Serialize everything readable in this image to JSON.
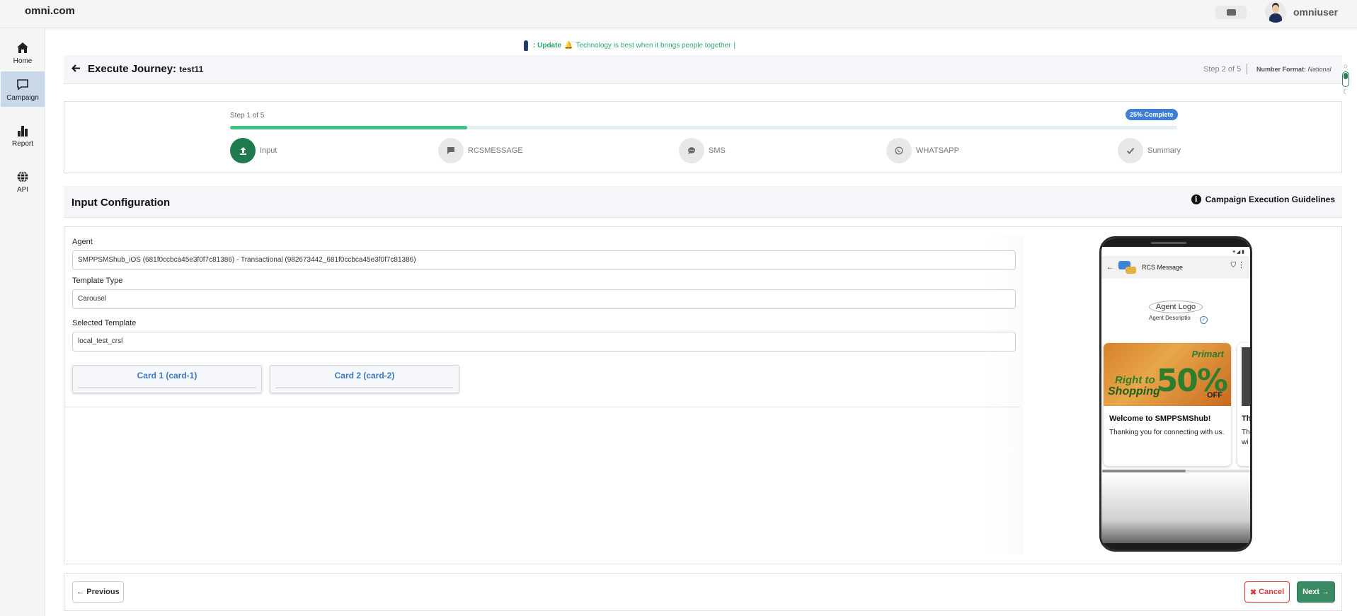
{
  "app": {
    "brand": "omni.com",
    "username": "omniuser"
  },
  "sidebar": {
    "items": [
      {
        "label": "Home",
        "icon": "home-icon"
      },
      {
        "label": "Campaign",
        "icon": "chat-icon",
        "active": true
      },
      {
        "label": "Report",
        "icon": "bar-chart-icon"
      },
      {
        "label": "API",
        "icon": "globe-icon"
      }
    ]
  },
  "ticker": {
    "prefix": ": Update",
    "message": "Technology is best when it brings people together",
    "suffix": "|"
  },
  "header": {
    "title": "Execute Journey:",
    "journey_name": "test11",
    "step_indicator": "Step 2 of 5",
    "number_format_label": "Number Format:",
    "number_format_value": "National"
  },
  "stepper": {
    "step_of": "Step 1 of 5",
    "complete_badge": "25% Complete",
    "progress_percent": 25,
    "steps": [
      {
        "label": "Input",
        "icon": "upload-icon",
        "active": true
      },
      {
        "label": "RCSMESSAGE",
        "icon": "message-square-icon"
      },
      {
        "label": "SMS",
        "icon": "chat-bubble-icon"
      },
      {
        "label": "WHATSAPP",
        "icon": "whatsapp-icon"
      },
      {
        "label": "Summary",
        "icon": "check-icon"
      }
    ]
  },
  "section": {
    "title": "Input Configuration",
    "guidelines_label": "Campaign Execution Guidelines"
  },
  "form": {
    "agent_label": "Agent",
    "agent_value": "SMPPSMShub_iOS (681f0ccbca45e3f0f7c81386) - Transactional (982673442_681f0ccbca45e3f0f7c81386)",
    "template_type_label": "Template Type",
    "template_type_value": "Carousel",
    "selected_template_label": "Selected Template",
    "selected_template_value": "local_test_crsl",
    "cards": [
      {
        "label": "Card 1 (card-1)"
      },
      {
        "label": "Card 2 (card-2)"
      }
    ]
  },
  "preview": {
    "header_title": "RCS Message",
    "agent_logo": "Agent Logo",
    "agent_description": "Agent Descriptio",
    "card_image_brand": "Primart",
    "card_image_headline_1": "Right to",
    "card_image_headline_2": "Shopping",
    "card_image_discount": "50%",
    "card_image_off": "OFF",
    "card_title": "Welcome to SMPPSMShub!",
    "card_description": "Thanking you for connecting with us.",
    "peek_title": "Th",
    "peek_desc_1": "Th",
    "peek_desc_2": "wi",
    "scroll_position": 0.56
  },
  "footer": {
    "previous_label": "Previous",
    "cancel_label": "Cancel",
    "next_label": "Next"
  },
  "colors": {
    "accent_green": "#3cc384",
    "active_step": "#1f7a4d",
    "badge_blue": "#3f7fd3",
    "cancel_red": "#d93a3a",
    "next_green": "#3c8a63"
  }
}
